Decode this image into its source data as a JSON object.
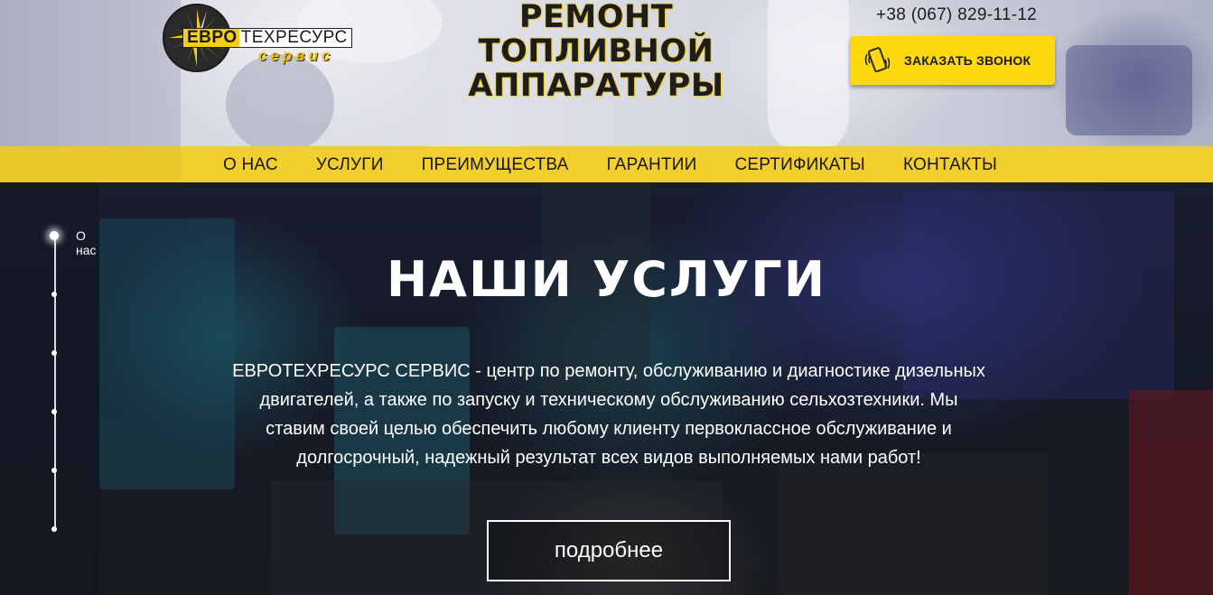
{
  "header": {
    "logo": {
      "part1": "ЕВРО",
      "part2": "ТЕХРЕСУРС",
      "sub": "сервис"
    },
    "title_lines": [
      "РЕМОНТ",
      "ТОПЛИВНОЙ",
      "АППАРАТУРЫ"
    ],
    "phone": "+38 (067) 829-11-12",
    "call_button": {
      "label": "ЗАКАЗАТЬ ЗВОНОК",
      "icon": "phone-vibrate-icon"
    }
  },
  "nav": {
    "items": [
      {
        "label": "О НАС"
      },
      {
        "label": "УСЛУГИ"
      },
      {
        "label": "ПРЕИМУЩЕСТВА"
      },
      {
        "label": "ГАРАНТИИ"
      },
      {
        "label": "СЕРТИФИКАТЫ"
      },
      {
        "label": "КОНТАКТЫ"
      }
    ]
  },
  "side_nav": {
    "active_label": "О нас",
    "count": 6
  },
  "hero": {
    "title": "НАШИ УСЛУГИ",
    "text_lines": [
      "ЕВРОТЕХРЕСУРС СЕРВИС - центр по ремонту, обслуживанию и диагностике дизельных",
      "двигателей, а также по запуску и техническому обслуживанию сельхозтехники. Мы",
      "ставим своей целью обеспечить любому клиенту первоклассное обслуживание и",
      "долгосрочный, надежный результат всех видов выполняемых нами работ!"
    ],
    "button_label": "подробнее"
  },
  "colors": {
    "accent_yellow": "#f3cf2e",
    "button_yellow": "#fcd80d",
    "text_dark": "#1b1b1b"
  }
}
